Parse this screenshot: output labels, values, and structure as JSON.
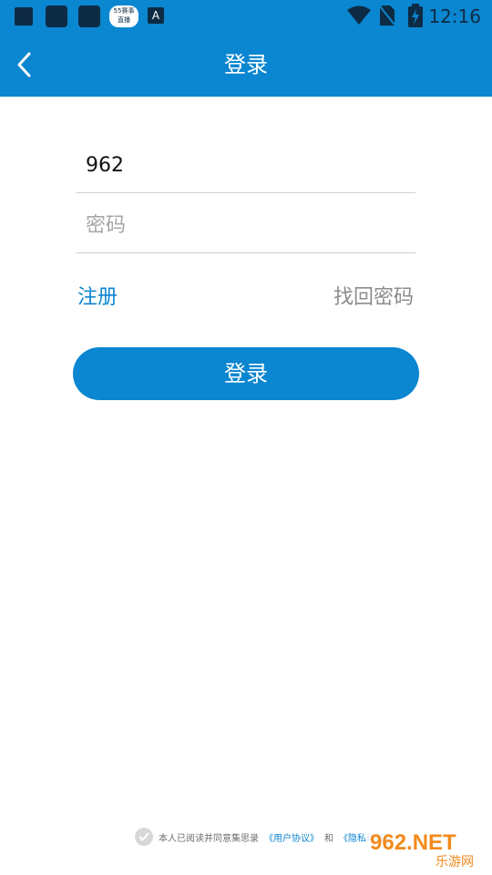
{
  "status_bar": {
    "time": "12:16",
    "notification_badge_line1": "55赛事",
    "notification_badge_line2": "直播",
    "notification_letter": "A"
  },
  "header": {
    "title": "登录"
  },
  "form": {
    "username_value": "962",
    "password_placeholder": "密码",
    "register_label": "注册",
    "forgot_password_label": "找回密码",
    "login_button_label": "登录"
  },
  "agreement": {
    "prefix": "本人已阅读并同意集思录",
    "user_agreement": "《用户协议》",
    "and": "和",
    "privacy_policy": "《隐私政策》"
  },
  "watermark": {
    "brand": "962.NET",
    "caption": "乐游网"
  },
  "colors": {
    "primary_blue": "#0b86d0",
    "dark_icon": "#0d2b44",
    "divider_gray": "#cfcfcf",
    "placeholder_gray": "#a6a6a6",
    "link_gray": "#8c8c8c",
    "watermark_orange": "#f28a1c"
  }
}
